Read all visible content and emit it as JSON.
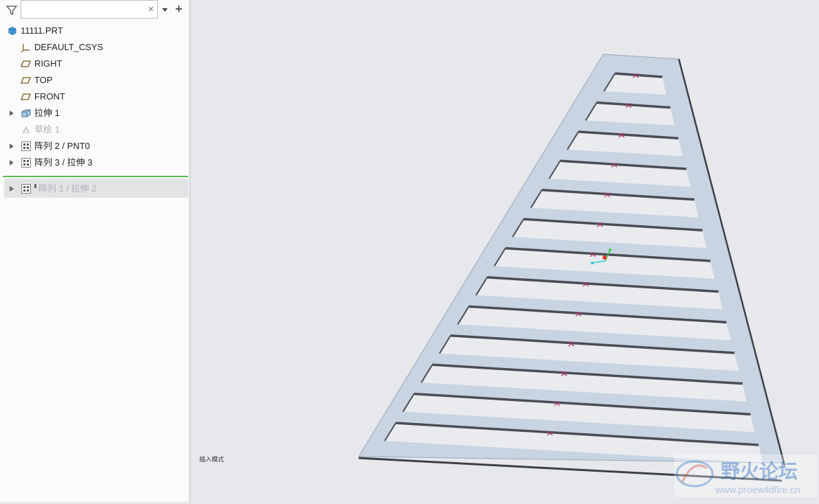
{
  "filter": {
    "search_value": "",
    "clear_symbol": "×",
    "add_symbol": "+"
  },
  "tree": {
    "root": {
      "label": "11111.PRT",
      "icon": "part-icon"
    },
    "items": [
      {
        "label": "DEFAULT_CSYS",
        "icon": "csys-icon",
        "expandable": false,
        "dimmed": false
      },
      {
        "label": "RIGHT",
        "icon": "datum-plane-icon",
        "expandable": false,
        "dimmed": false
      },
      {
        "label": "TOP",
        "icon": "datum-plane-icon",
        "expandable": false,
        "dimmed": false
      },
      {
        "label": "FRONT",
        "icon": "datum-plane-icon",
        "expandable": false,
        "dimmed": false
      },
      {
        "label": "拉伸 1",
        "icon": "extrude-icon",
        "expandable": true,
        "dimmed": false
      },
      {
        "label": "草绘 1",
        "icon": "sketch-icon",
        "expandable": false,
        "dimmed": true
      },
      {
        "label": "阵列 2 / PNT0",
        "icon": "pattern-icon",
        "expandable": true,
        "dimmed": false
      },
      {
        "label": "阵列 3 / 拉伸 3",
        "icon": "pattern-icon",
        "expandable": true,
        "dimmed": false
      }
    ],
    "after_insert": {
      "label": "阵列 1 / 拉伸 2",
      "icon": "pattern-icon",
      "expandable": true,
      "dimmed": true
    }
  },
  "viewport": {
    "status_text": "插入模式"
  },
  "watermark": {
    "title": "野火论坛",
    "url": "www.proewildfire.cn"
  },
  "colors": {
    "model_face": "#c9d4e2",
    "slot_edge": "#4a4d55",
    "point_marker": "#b0306a",
    "insert_line": "#57c24a"
  }
}
